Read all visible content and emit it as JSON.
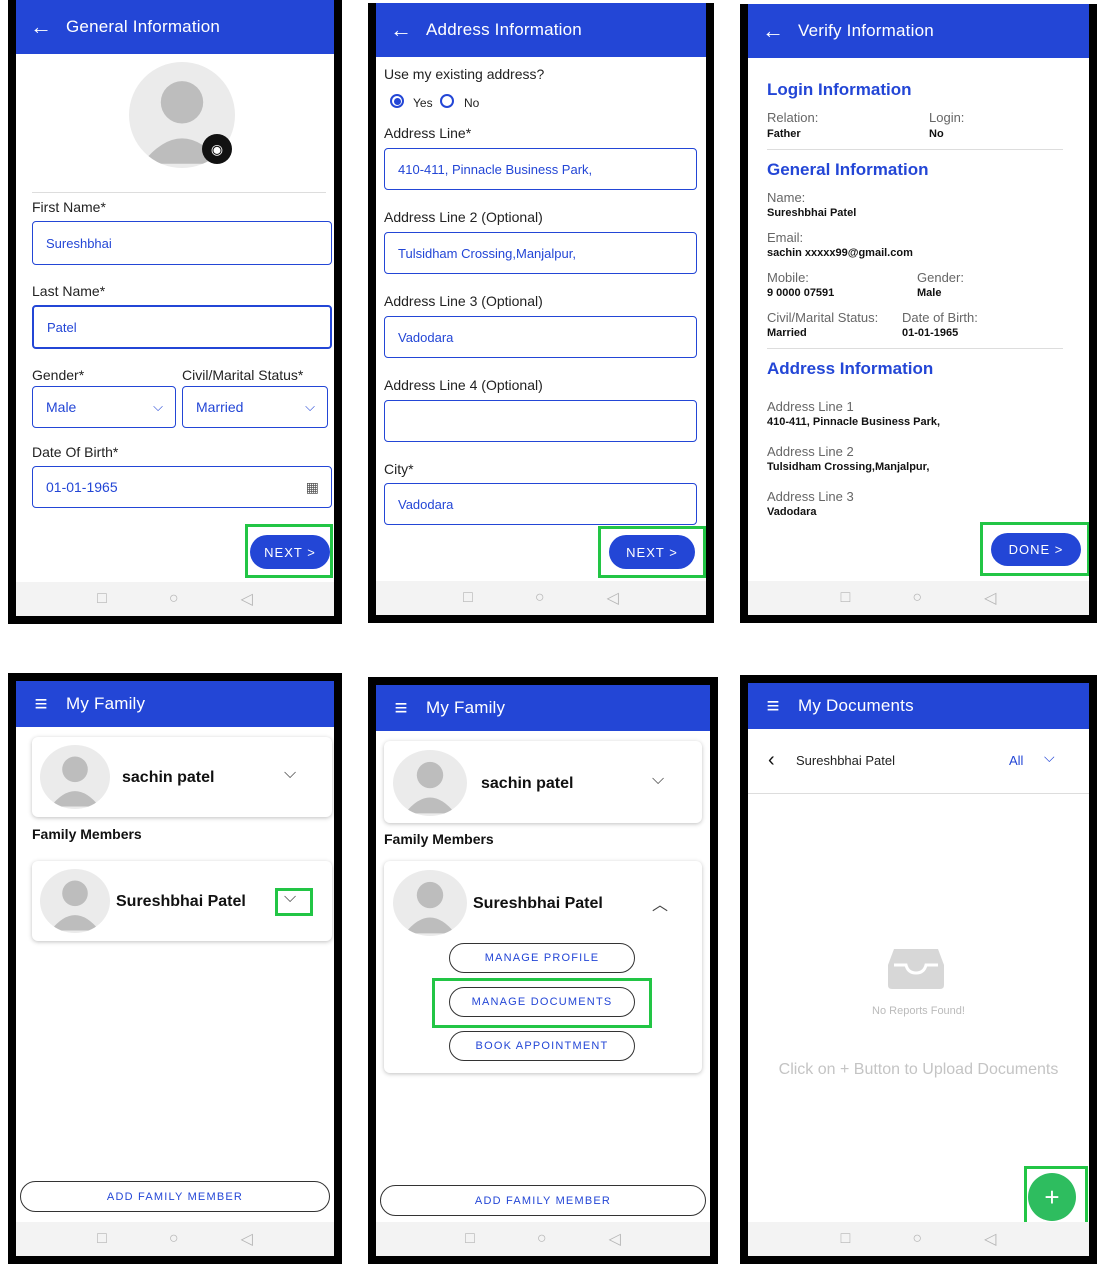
{
  "colors": {
    "primary": "#2346d6",
    "highlight": "#22c545",
    "fab": "#2ebd5f"
  },
  "icons": {
    "back": "arrow-left-icon",
    "menu": "hamburger-menu-icon",
    "camera": "camera-icon",
    "calendar": "calendar-icon",
    "chevron_down": "chevron-down-icon",
    "chevron_up": "chevron-up-icon",
    "chevron_left": "chevron-left-icon",
    "inbox": "empty-inbox-icon",
    "add": "plus-icon"
  },
  "nav": {
    "back_arrow": "←",
    "menu": "≡",
    "square": "□",
    "circle": "○",
    "triangle": "◁"
  },
  "screen1": {
    "title": "General Information",
    "first_name_label": "First Name*",
    "first_name": "Sureshbhai",
    "last_name_label": "Last Name*",
    "last_name": "Patel",
    "gender_label": "Gender*",
    "gender": "Male",
    "marital_label": "Civil/Marital Status*",
    "marital": "Married",
    "dob_label": "Date Of Birth*",
    "dob": "01-01-1965",
    "next": "NEXT >"
  },
  "screen2": {
    "title": "Address Information",
    "question": "Use my existing address?",
    "yes": "Yes",
    "no": "No",
    "line1_label": "Address Line*",
    "line1": "410-411, Pinnacle Business Park,",
    "line2_label": "Address Line 2 (Optional)",
    "line2": "Tulsidham Crossing,Manjalpur,",
    "line3_label": "Address Line 3 (Optional)",
    "line3": "Vadodara",
    "line4_label": "Address Line 4 (Optional)",
    "line4": "",
    "city_label": "City*",
    "city": "Vadodara",
    "next": "NEXT >"
  },
  "screen3": {
    "title": "Verify Information",
    "login_heading": "Login Information",
    "relation_label": "Relation:",
    "relation": "Father",
    "login_label": "Login:",
    "login": "No",
    "general_heading": "General Information",
    "name_label": "Name:",
    "name": "Sureshbhai Patel",
    "email_label": "Email:",
    "email": "sachin xxxxx99@gmail.com",
    "mobile_label": "Mobile:",
    "mobile": "9 0000 07591",
    "gender_label": "Gender:",
    "gender": "Male",
    "civil_label": "Civil/Marital Status:",
    "civil": "Married",
    "dob_label": "Date of Birth:",
    "dob": "01-01-1965",
    "address_heading": "Address Information",
    "addr1_label": "Address Line 1",
    "addr1": "410-411, Pinnacle Business Park,",
    "addr2_label": "Address Line 2",
    "addr2": "Tulsidham Crossing,Manjalpur,",
    "addr3_label": "Address Line 3",
    "addr3": "Vadodara",
    "done": "DONE >"
  },
  "screen4": {
    "title": "My Family",
    "primary_name": "sachin patel",
    "members_heading": "Family Members",
    "member_name": "Sureshbhai Patel",
    "add_member": "ADD FAMILY MEMBER"
  },
  "screen5": {
    "title": "My Family",
    "primary_name": "sachin patel",
    "members_heading": "Family Members",
    "member_name": "Sureshbhai Patel",
    "manage_profile": "MANAGE PROFILE",
    "manage_documents": "MANAGE DOCUMENTS",
    "book_appointment": "BOOK APPOINTMENT",
    "add_member": "ADD FAMILY MEMBER"
  },
  "screen6": {
    "title": "My Documents",
    "person": "Sureshbhai Patel",
    "filter": "All",
    "empty_title": "No Reports Found!",
    "empty_hint": "Click on + Button to Upload Documents",
    "fab": "+"
  }
}
